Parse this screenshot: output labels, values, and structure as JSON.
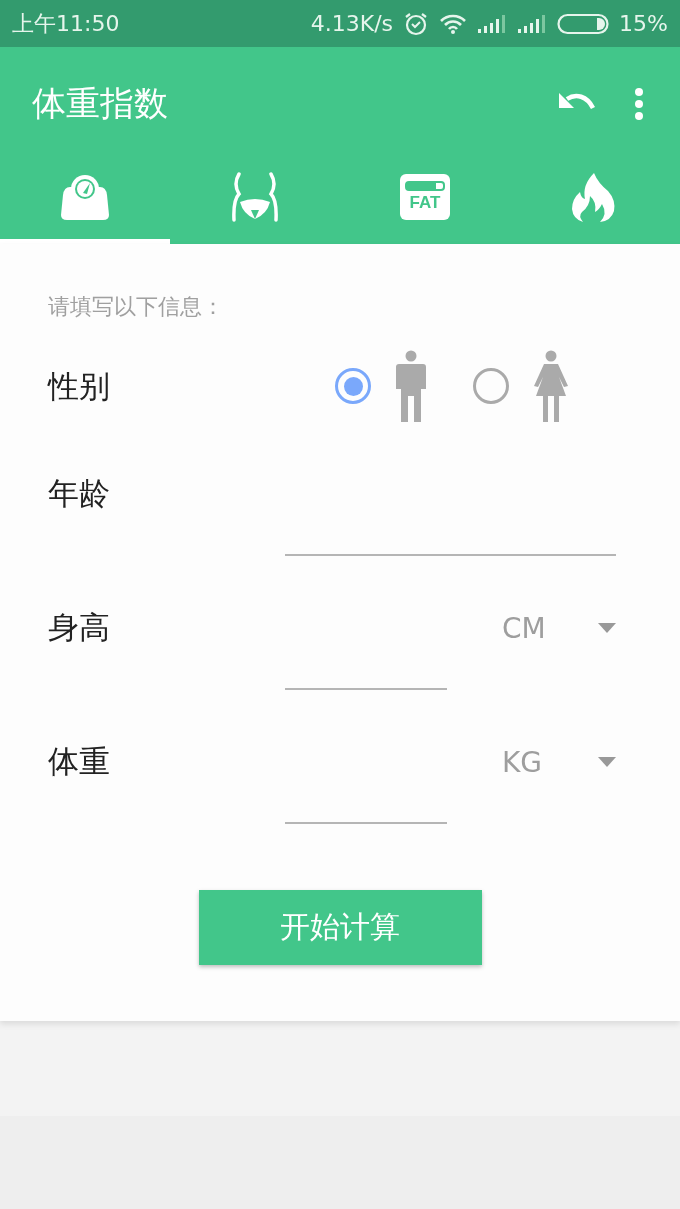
{
  "status_bar": {
    "time": "上午11:50",
    "speed": "4.13K/s",
    "battery": "15%"
  },
  "app_bar": {
    "title": "体重指数"
  },
  "tabs": [
    {
      "kind": "scale",
      "selected": true
    },
    {
      "kind": "body",
      "selected": false
    },
    {
      "kind": "fat",
      "text": "FAT",
      "selected": false
    },
    {
      "kind": "fire",
      "selected": false
    }
  ],
  "form": {
    "hint": "请填写以下信息：",
    "gender": {
      "label": "性别",
      "options": [
        {
          "kind": "male",
          "selected": true
        },
        {
          "kind": "female",
          "selected": false
        }
      ]
    },
    "fields": [
      {
        "label": "年龄"
      },
      {
        "label": "身高",
        "unit": "CM"
      },
      {
        "label": "体重",
        "unit": "KG"
      }
    ],
    "button": "开始计算"
  }
}
